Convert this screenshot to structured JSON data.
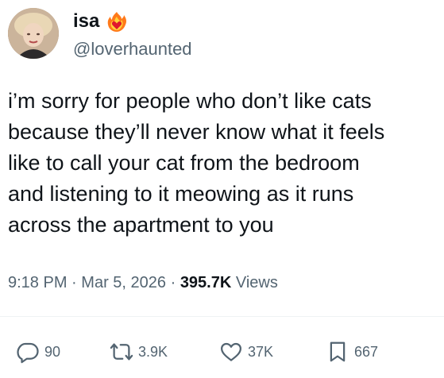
{
  "author": {
    "display_name": "isa",
    "handle": "@loverhaunted",
    "badge_icon": "fire-heart-icon"
  },
  "tweet": {
    "text": "i’m sorry for people who don’t like cats\nbecause they’ll never know what it feels\nlike to call your cat from the bedroom\nand listening to it meowing as it runs\nacross the apartment to you"
  },
  "meta": {
    "time": "9:18 PM",
    "separator": "·",
    "date": "Mar 5, 2026",
    "views_count": "395.7K",
    "views_label": "Views"
  },
  "actions": {
    "replies": "90",
    "reposts": "3.9K",
    "likes": "37K",
    "bookmarks": "667"
  },
  "colors": {
    "text": "#0f1419",
    "secondary": "#536471",
    "divider": "#eff3f4"
  }
}
